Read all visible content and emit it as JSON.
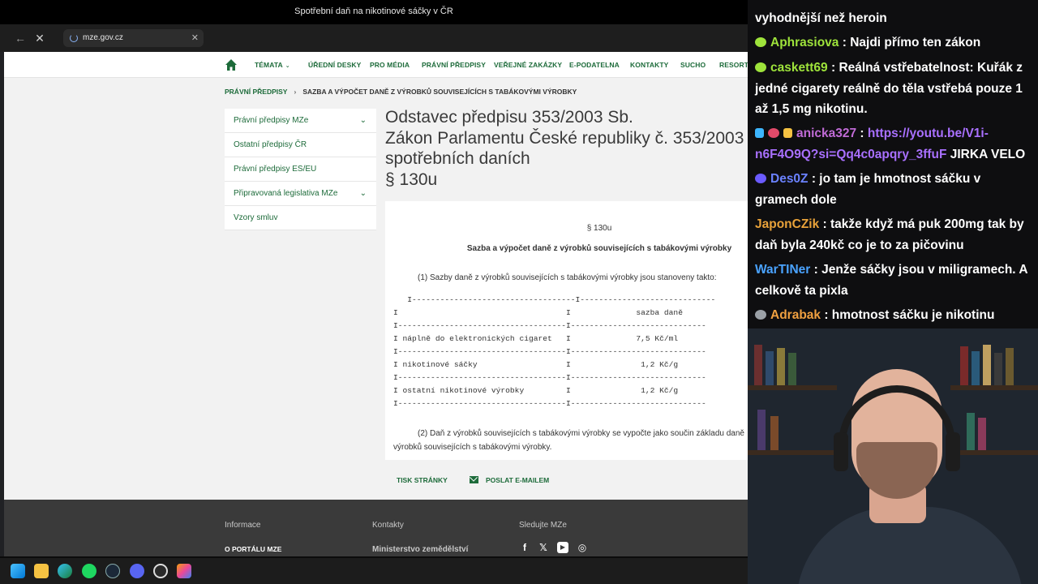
{
  "window": {
    "title": "Spotřební daň na nikotinové sáčky v ČR"
  },
  "browser": {
    "url": "mze.gov.cz",
    "back_icon": "arrow-left-icon",
    "stop_icon": "close-icon"
  },
  "nav": {
    "items": [
      {
        "label": "TÉMATA",
        "has_dropdown": true
      },
      {
        "label": "ÚŘEDNÍ DESKY"
      },
      {
        "label": "PRO MÉDIA"
      },
      {
        "label": "PRÁVNÍ PŘEDPISY"
      },
      {
        "label": "VEŘEJNÉ ZAKÁZKY"
      },
      {
        "label": "E-PODATELNA"
      },
      {
        "label": "KONTAKTY"
      },
      {
        "label": "SUCHO"
      },
      {
        "label": "RESORTN"
      }
    ],
    "chevron": "⌄"
  },
  "breadcrumb": {
    "link": "PRÁVNÍ PŘEDPISY",
    "separator": "›",
    "current": "SAZBA A VÝPOČET DANĚ Z VÝROBKŮ SOUVISEJÍCÍCH S TABÁKOVÝMI VÝROBKY"
  },
  "sidebar": {
    "items": [
      {
        "label": "Právní předpisy MZe",
        "expandable": true
      },
      {
        "label": "Ostatní předpisy ČR"
      },
      {
        "label": "Právní předpisy ES/EU"
      },
      {
        "label": "Připravovaná legislativa MZe",
        "expandable": true
      },
      {
        "label": "Vzory smluv"
      }
    ],
    "chevron": "⌄"
  },
  "document": {
    "heading_lines": [
      "Odstavec předpisu 353/2003 Sb.",
      "Zákon Parlamentu České republiky č. 353/2003",
      "spotřebních daních",
      "§ 130u"
    ],
    "para_number": "§ 130u",
    "para_title": "Sazba a výpočet daně z výrobků souvisejících s tabákovými výrobky",
    "para_1": "(1) Sazby daně z výrobků souvisejících s tabákovými výrobky jsou stanoveny takto:",
    "table_text": "   I-----------------------------------I-----------------------------\nI                                    I              sazba daně\nI------------------------------------I-----------------------------\nI náplně do elektronických cigaret   I              7,5 Kč/ml\nI------------------------------------I-----------------------------\nI nikotinové sáčky                   I               1,2 Kč/g\nI------------------------------------I-----------------------------\nI ostatní nikotinové výrobky         I               1,2 Kč/g\nI------------------------------------I-----------------------------",
    "para_2": "(2) Daň z výrobků souvisejících s tabákovými výrobky se vypočte jako součin základu daně výrobků souvisejících s tabákovými výrobky."
  },
  "actions": {
    "print": "TISK STRÁNKY",
    "mail": "POSLAT E-MAILEM"
  },
  "footer": {
    "col1_head": "Informace",
    "col1_link": "O PORTÁLU MZE",
    "col2_head": "Kontakty",
    "col2_value": "Ministerstvo zemědělství",
    "col3_head": "Sledujte MZe",
    "social": [
      "f",
      "𝕏",
      "▶",
      "◎"
    ]
  },
  "taskbar": {
    "icons": [
      "windows-start-icon",
      "file-explorer-icon",
      "edge-icon",
      "spotify-icon",
      "steam-icon",
      "discord-icon",
      "obs-icon",
      "copilot-icon"
    ]
  },
  "chat": {
    "messages": [
      {
        "user": "",
        "text": "vyhodnější než heroin",
        "user_color": "#ffffff"
      },
      {
        "user": "Aphrasiova",
        "text": " : Najdi přímo ten zákon",
        "user_color": "#9ee33b",
        "badge_color": "#9ee33b"
      },
      {
        "user": "caskett69",
        "text": " : Reálná vstřebatelnost: Kuřák z jedné cigarety reálně do těla vstřebá pouze 1 až 1,5 mg nikotinu.",
        "user_color": "#9ee33b",
        "badge_color": "#9ee33b"
      },
      {
        "user": "anicka327",
        "text": " : ",
        "link": "https://youtu.be/V1i-n6F4O9Q?si=Qq4c0apqry_3ffuF",
        "after": " JIRKA VELO",
        "user_color": "#c06bd6",
        "badge_color": "#3db6ff"
      },
      {
        "user": "Des0Z",
        "text": " : jo tam je hmotnost sáčku v gramech dole",
        "user_color": "#6b82ff",
        "badge_color": "#6b5bff"
      },
      {
        "user": "JaponCZik",
        "text": " : takže když má puk 200mg tak by daň byla 240kč co je to za pičovinu",
        "user_color": "#e8a23a"
      },
      {
        "user": "WarTINer",
        "text": " : Jenže sáčky jsou v miligramech. A celkově ta pixla",
        "user_color": "#4aa3ff"
      },
      {
        "user": "Adrabak",
        "text": " : hmotnost sáčku je nikotinu",
        "user_color": "#f0a040",
        "badge_color": "#9aa0a6"
      }
    ]
  },
  "colors": {
    "brand_green": "#1d6b3a",
    "footer_bg": "#3a3a3a",
    "chat_bg": "#0e0e10"
  }
}
